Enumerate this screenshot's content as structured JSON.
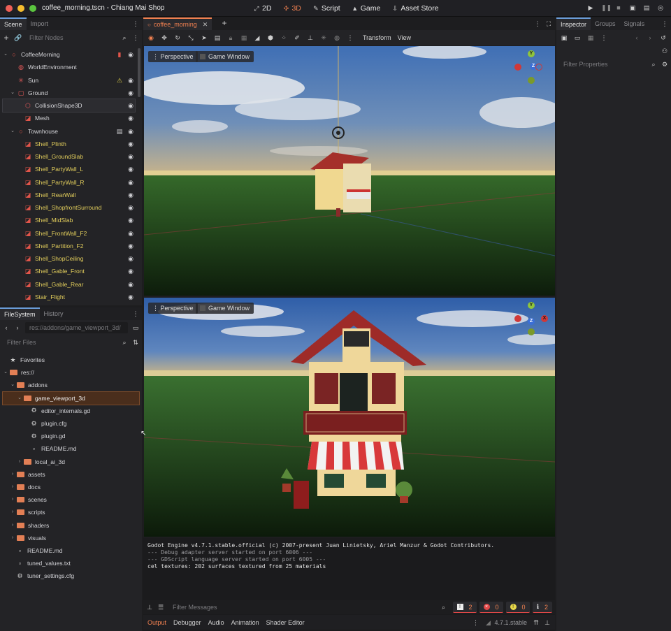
{
  "window": {
    "title": "coffee_morning.tscn - Chiang Mai Shop"
  },
  "main_tabs": [
    {
      "label": "2D",
      "icon": "2d-icon",
      "active": false
    },
    {
      "label": "3D",
      "icon": "3d-icon",
      "active": true
    },
    {
      "label": "Script",
      "icon": "script-icon",
      "active": false
    },
    {
      "label": "Game",
      "icon": "game-icon",
      "active": false
    },
    {
      "label": "Asset Store",
      "icon": "asset-store-icon",
      "active": false
    }
  ],
  "scene_dock": {
    "tabs": [
      "Scene",
      "Import"
    ],
    "filter_placeholder": "Filter Nodes",
    "nodes": [
      {
        "name": "CoffeeMorning",
        "depth": 0,
        "icon": "node3d-icon",
        "expanded": true
      },
      {
        "name": "WorldEnvironment",
        "depth": 1,
        "icon": "world-environment-icon"
      },
      {
        "name": "Sun",
        "depth": 1,
        "icon": "directional-light-icon",
        "warning": true
      },
      {
        "name": "Ground",
        "depth": 1,
        "icon": "static-body-icon",
        "expanded": true
      },
      {
        "name": "CollisionShape3D",
        "depth": 2,
        "icon": "collision-shape-icon",
        "selected": true
      },
      {
        "name": "Mesh",
        "depth": 2,
        "icon": "mesh-instance-icon"
      },
      {
        "name": "Townhouse",
        "depth": 1,
        "icon": "node3d-icon",
        "expanded": true,
        "film": true
      },
      {
        "name": "Shell_Plinth",
        "depth": 2,
        "icon": "mesh-instance-icon",
        "yellow": true
      },
      {
        "name": "Shell_GroundSlab",
        "depth": 2,
        "icon": "mesh-instance-icon",
        "yellow": true
      },
      {
        "name": "Shell_PartyWall_L",
        "depth": 2,
        "icon": "mesh-instance-icon",
        "yellow": true
      },
      {
        "name": "Shell_PartyWall_R",
        "depth": 2,
        "icon": "mesh-instance-icon",
        "yellow": true
      },
      {
        "name": "Shell_RearWall",
        "depth": 2,
        "icon": "mesh-instance-icon",
        "yellow": true
      },
      {
        "name": "Shell_ShopfrontSurround",
        "depth": 2,
        "icon": "mesh-instance-icon",
        "yellow": true
      },
      {
        "name": "Shell_MidSlab",
        "depth": 2,
        "icon": "mesh-instance-icon",
        "yellow": true
      },
      {
        "name": "Shell_FrontWall_F2",
        "depth": 2,
        "icon": "mesh-instance-icon",
        "yellow": true
      },
      {
        "name": "Shell_Partition_F2",
        "depth": 2,
        "icon": "mesh-instance-icon",
        "yellow": true
      },
      {
        "name": "Shell_ShopCeiling",
        "depth": 2,
        "icon": "mesh-instance-icon",
        "yellow": true
      },
      {
        "name": "Shell_Gable_Front",
        "depth": 2,
        "icon": "mesh-instance-icon",
        "yellow": true
      },
      {
        "name": "Shell_Gable_Rear",
        "depth": 2,
        "icon": "mesh-instance-icon",
        "yellow": true
      },
      {
        "name": "Stair_Flight",
        "depth": 2,
        "icon": "mesh-instance-icon",
        "yellow": true
      }
    ]
  },
  "filesystem_dock": {
    "tabs": [
      "FileSystem",
      "History"
    ],
    "path": "res://addons/game_viewport_3d/",
    "filter_placeholder": "Filter Files",
    "items": [
      {
        "name": "Favorites",
        "depth": 0,
        "type": "favorites"
      },
      {
        "name": "res://",
        "depth": 0,
        "type": "folder",
        "expanded": true
      },
      {
        "name": "addons",
        "depth": 1,
        "type": "folder",
        "expanded": true
      },
      {
        "name": "game_viewport_3d",
        "depth": 2,
        "type": "folder",
        "expanded": true,
        "selected": true
      },
      {
        "name": "editor_internals.gd",
        "depth": 3,
        "type": "gear"
      },
      {
        "name": "plugin.cfg",
        "depth": 3,
        "type": "gear"
      },
      {
        "name": "plugin.gd",
        "depth": 3,
        "type": "gear"
      },
      {
        "name": "README.md",
        "depth": 3,
        "type": "file"
      },
      {
        "name": "local_ai_3d",
        "depth": 2,
        "type": "folder"
      },
      {
        "name": "assets",
        "depth": 1,
        "type": "folder"
      },
      {
        "name": "docs",
        "depth": 1,
        "type": "folder"
      },
      {
        "name": "scenes",
        "depth": 1,
        "type": "folder"
      },
      {
        "name": "scripts",
        "depth": 1,
        "type": "folder"
      },
      {
        "name": "shaders",
        "depth": 1,
        "type": "folder"
      },
      {
        "name": "visuals",
        "depth": 1,
        "type": "folder"
      },
      {
        "name": "README.md",
        "depth": 1,
        "type": "file"
      },
      {
        "name": "tuned_values.txt",
        "depth": 1,
        "type": "file"
      },
      {
        "name": "tuner_settings.cfg",
        "depth": 1,
        "type": "gear"
      }
    ]
  },
  "editor": {
    "scene_tab": "coffee_morning",
    "toolbar_menus": [
      "Transform",
      "View"
    ],
    "viewports": [
      {
        "perspective_label": "Perspective",
        "game_window_label": "Game Window"
      },
      {
        "perspective_label": "Perspective",
        "game_window_label": "Game Window"
      }
    ],
    "gizmo_labels": {
      "y": "Y",
      "z": "Z",
      "x": "X"
    }
  },
  "output": {
    "lines": [
      {
        "text": "Godot Engine v4.7.1.stable.official (c) 2007-present Juan Linietsky, Ariel Manzur & Godot Contributors.",
        "dim": false
      },
      {
        "text": "--- Debug adapter server started on port 6006 ---",
        "dim": true
      },
      {
        "text": "--- GDScript language server started on port 6005 ---",
        "dim": true
      },
      {
        "text": "cel textures: 202 surfaces textured from 25 materials",
        "dim": false
      }
    ],
    "filter_placeholder": "Filter Messages",
    "counts": {
      "messages": "2",
      "errors": "0",
      "warnings": "0",
      "info": "2"
    },
    "tabs": [
      "Output",
      "Debugger",
      "Audio",
      "Animation",
      "Shader Editor"
    ],
    "version": "4.7.1.stable"
  },
  "inspector": {
    "tabs": [
      "Inspector",
      "Groups",
      "Signals"
    ],
    "filter_placeholder": "Filter Properties"
  },
  "colors": {
    "accent": "#f08050",
    "selection": "#3a2a20",
    "folder": "#e27f55",
    "mesh_icon": "#e2554a",
    "warning_text": "#e4cf5c"
  }
}
